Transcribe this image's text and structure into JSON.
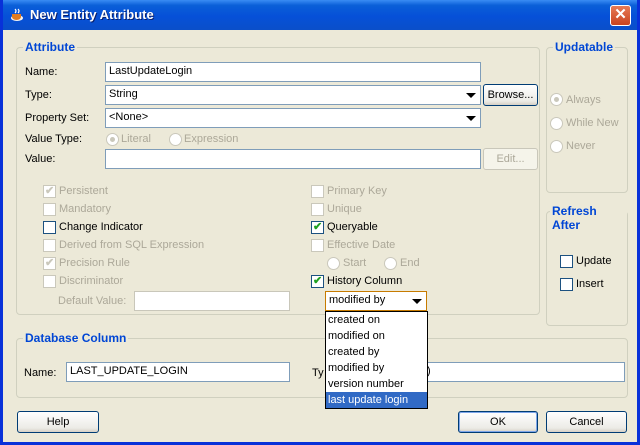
{
  "window": {
    "title": "New Entity Attribute"
  },
  "attribute": {
    "group_title": "Attribute",
    "name_label": "Name:",
    "name_value": "LastUpdateLogin",
    "type_label": "Type:",
    "type_value": "String",
    "browse_label": "Browse...",
    "property_set_label": "Property Set:",
    "property_set_value": "<None>",
    "value_type_label": "Value Type:",
    "literal_label": "Literal",
    "expression_label": "Expression",
    "value_label": "Value:",
    "value_value": "",
    "edit_label": "Edit...",
    "persistent_label": "Persistent",
    "mandatory_label": "Mandatory",
    "change_indicator_label": "Change Indicator",
    "derived_label": "Derived from SQL Expression",
    "precision_label": "Precision Rule",
    "discriminator_label": "Discriminator",
    "default_value_label": "Default Value:",
    "default_value_value": "",
    "primary_key_label": "Primary Key",
    "unique_label": "Unique",
    "queryable_label": "Queryable",
    "effective_date_label": "Effective Date",
    "start_label": "Start",
    "end_label": "End",
    "history_column_label": "History Column",
    "history_value": "modified by"
  },
  "history_options": [
    "created on",
    "modified on",
    "created by",
    "modified by",
    "version number",
    "last update login"
  ],
  "updatable": {
    "group_title": "Updatable",
    "always_label": "Always",
    "while_new_label": "While New",
    "never_label": "Never"
  },
  "refresh_after": {
    "group_title": "Refresh After",
    "update_label": "Update",
    "insert_label": "Insert"
  },
  "database_column": {
    "group_title": "Database Column",
    "name_label": "Name:",
    "name_value": "LAST_UPDATE_LOGIN",
    "type_label_partial": "Ty",
    "type_value_partial": ")"
  },
  "buttons": {
    "help": "Help",
    "ok": "OK",
    "cancel": "Cancel"
  }
}
